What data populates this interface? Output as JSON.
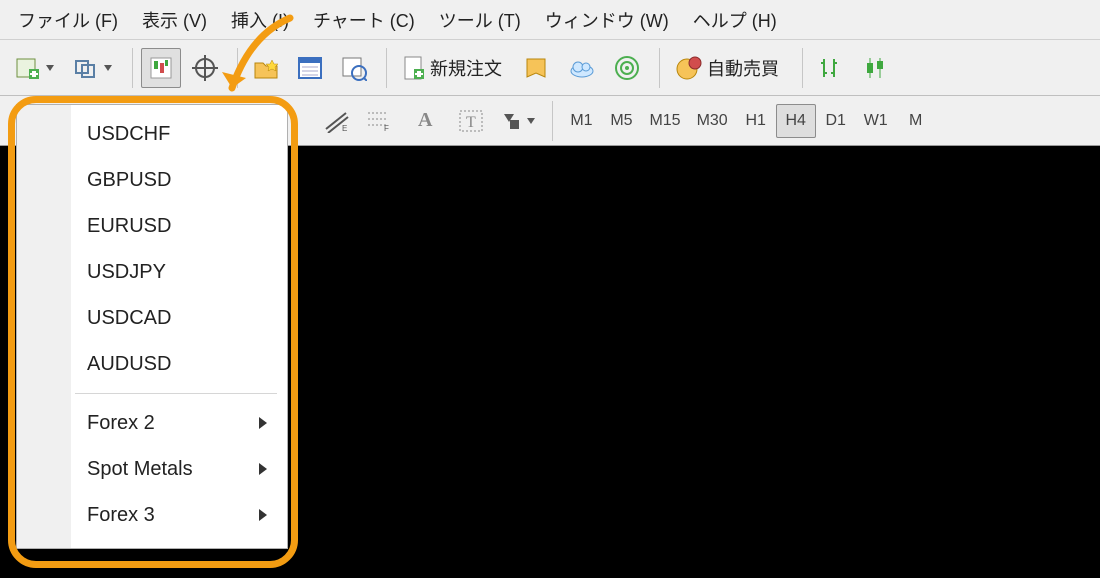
{
  "menubar": {
    "file": "ファイル (F)",
    "view": "表示 (V)",
    "insert": "挿入 (I)",
    "chart": "チャート (C)",
    "tool": "ツール (T)",
    "window": "ウィンドウ (W)",
    "help": "ヘルプ (H)"
  },
  "toolbar1": {
    "neworder": "新規注文",
    "autotrade": "自動売買"
  },
  "timeframes": {
    "m1": "M1",
    "m5": "M5",
    "m15": "M15",
    "m30": "M30",
    "h1": "H1",
    "h4": "H4",
    "d1": "D1",
    "w1": "W1",
    "mn": "M"
  },
  "popup": {
    "items": [
      "USDCHF",
      "GBPUSD",
      "EURUSD",
      "USDJPY",
      "USDCAD",
      "AUDUSD"
    ],
    "submenus": [
      "Forex 2",
      "Spot Metals",
      "Forex 3"
    ]
  }
}
